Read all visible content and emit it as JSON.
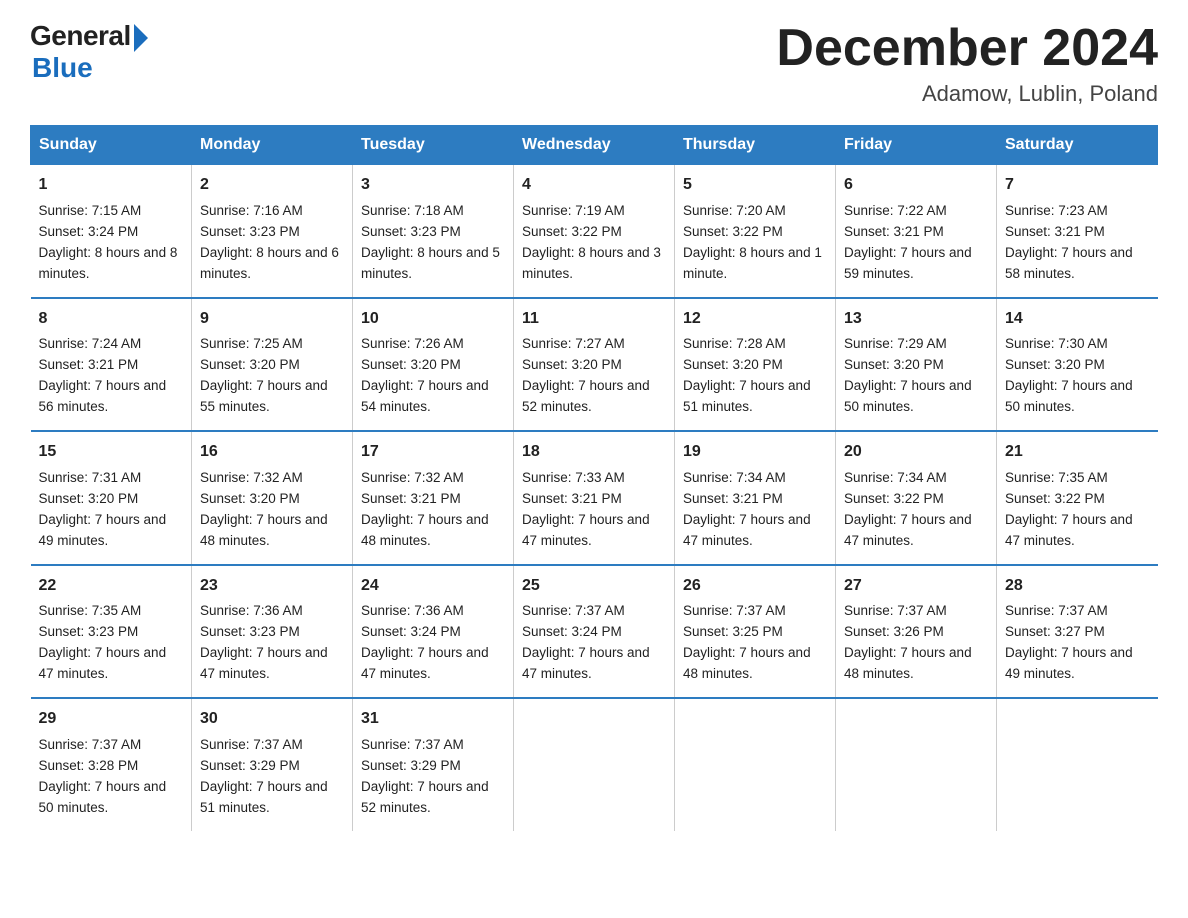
{
  "logo": {
    "general": "General",
    "blue": "Blue"
  },
  "title": "December 2024",
  "location": "Adamow, Lublin, Poland",
  "days_header": [
    "Sunday",
    "Monday",
    "Tuesday",
    "Wednesday",
    "Thursday",
    "Friday",
    "Saturday"
  ],
  "weeks": [
    [
      {
        "day": "1",
        "sunrise": "Sunrise: 7:15 AM",
        "sunset": "Sunset: 3:24 PM",
        "daylight": "Daylight: 8 hours and 8 minutes."
      },
      {
        "day": "2",
        "sunrise": "Sunrise: 7:16 AM",
        "sunset": "Sunset: 3:23 PM",
        "daylight": "Daylight: 8 hours and 6 minutes."
      },
      {
        "day": "3",
        "sunrise": "Sunrise: 7:18 AM",
        "sunset": "Sunset: 3:23 PM",
        "daylight": "Daylight: 8 hours and 5 minutes."
      },
      {
        "day": "4",
        "sunrise": "Sunrise: 7:19 AM",
        "sunset": "Sunset: 3:22 PM",
        "daylight": "Daylight: 8 hours and 3 minutes."
      },
      {
        "day": "5",
        "sunrise": "Sunrise: 7:20 AM",
        "sunset": "Sunset: 3:22 PM",
        "daylight": "Daylight: 8 hours and 1 minute."
      },
      {
        "day": "6",
        "sunrise": "Sunrise: 7:22 AM",
        "sunset": "Sunset: 3:21 PM",
        "daylight": "Daylight: 7 hours and 59 minutes."
      },
      {
        "day": "7",
        "sunrise": "Sunrise: 7:23 AM",
        "sunset": "Sunset: 3:21 PM",
        "daylight": "Daylight: 7 hours and 58 minutes."
      }
    ],
    [
      {
        "day": "8",
        "sunrise": "Sunrise: 7:24 AM",
        "sunset": "Sunset: 3:21 PM",
        "daylight": "Daylight: 7 hours and 56 minutes."
      },
      {
        "day": "9",
        "sunrise": "Sunrise: 7:25 AM",
        "sunset": "Sunset: 3:20 PM",
        "daylight": "Daylight: 7 hours and 55 minutes."
      },
      {
        "day": "10",
        "sunrise": "Sunrise: 7:26 AM",
        "sunset": "Sunset: 3:20 PM",
        "daylight": "Daylight: 7 hours and 54 minutes."
      },
      {
        "day": "11",
        "sunrise": "Sunrise: 7:27 AM",
        "sunset": "Sunset: 3:20 PM",
        "daylight": "Daylight: 7 hours and 52 minutes."
      },
      {
        "day": "12",
        "sunrise": "Sunrise: 7:28 AM",
        "sunset": "Sunset: 3:20 PM",
        "daylight": "Daylight: 7 hours and 51 minutes."
      },
      {
        "day": "13",
        "sunrise": "Sunrise: 7:29 AM",
        "sunset": "Sunset: 3:20 PM",
        "daylight": "Daylight: 7 hours and 50 minutes."
      },
      {
        "day": "14",
        "sunrise": "Sunrise: 7:30 AM",
        "sunset": "Sunset: 3:20 PM",
        "daylight": "Daylight: 7 hours and 50 minutes."
      }
    ],
    [
      {
        "day": "15",
        "sunrise": "Sunrise: 7:31 AM",
        "sunset": "Sunset: 3:20 PM",
        "daylight": "Daylight: 7 hours and 49 minutes."
      },
      {
        "day": "16",
        "sunrise": "Sunrise: 7:32 AM",
        "sunset": "Sunset: 3:20 PM",
        "daylight": "Daylight: 7 hours and 48 minutes."
      },
      {
        "day": "17",
        "sunrise": "Sunrise: 7:32 AM",
        "sunset": "Sunset: 3:21 PM",
        "daylight": "Daylight: 7 hours and 48 minutes."
      },
      {
        "day": "18",
        "sunrise": "Sunrise: 7:33 AM",
        "sunset": "Sunset: 3:21 PM",
        "daylight": "Daylight: 7 hours and 47 minutes."
      },
      {
        "day": "19",
        "sunrise": "Sunrise: 7:34 AM",
        "sunset": "Sunset: 3:21 PM",
        "daylight": "Daylight: 7 hours and 47 minutes."
      },
      {
        "day": "20",
        "sunrise": "Sunrise: 7:34 AM",
        "sunset": "Sunset: 3:22 PM",
        "daylight": "Daylight: 7 hours and 47 minutes."
      },
      {
        "day": "21",
        "sunrise": "Sunrise: 7:35 AM",
        "sunset": "Sunset: 3:22 PM",
        "daylight": "Daylight: 7 hours and 47 minutes."
      }
    ],
    [
      {
        "day": "22",
        "sunrise": "Sunrise: 7:35 AM",
        "sunset": "Sunset: 3:23 PM",
        "daylight": "Daylight: 7 hours and 47 minutes."
      },
      {
        "day": "23",
        "sunrise": "Sunrise: 7:36 AM",
        "sunset": "Sunset: 3:23 PM",
        "daylight": "Daylight: 7 hours and 47 minutes."
      },
      {
        "day": "24",
        "sunrise": "Sunrise: 7:36 AM",
        "sunset": "Sunset: 3:24 PM",
        "daylight": "Daylight: 7 hours and 47 minutes."
      },
      {
        "day": "25",
        "sunrise": "Sunrise: 7:37 AM",
        "sunset": "Sunset: 3:24 PM",
        "daylight": "Daylight: 7 hours and 47 minutes."
      },
      {
        "day": "26",
        "sunrise": "Sunrise: 7:37 AM",
        "sunset": "Sunset: 3:25 PM",
        "daylight": "Daylight: 7 hours and 48 minutes."
      },
      {
        "day": "27",
        "sunrise": "Sunrise: 7:37 AM",
        "sunset": "Sunset: 3:26 PM",
        "daylight": "Daylight: 7 hours and 48 minutes."
      },
      {
        "day": "28",
        "sunrise": "Sunrise: 7:37 AM",
        "sunset": "Sunset: 3:27 PM",
        "daylight": "Daylight: 7 hours and 49 minutes."
      }
    ],
    [
      {
        "day": "29",
        "sunrise": "Sunrise: 7:37 AM",
        "sunset": "Sunset: 3:28 PM",
        "daylight": "Daylight: 7 hours and 50 minutes."
      },
      {
        "day": "30",
        "sunrise": "Sunrise: 7:37 AM",
        "sunset": "Sunset: 3:29 PM",
        "daylight": "Daylight: 7 hours and 51 minutes."
      },
      {
        "day": "31",
        "sunrise": "Sunrise: 7:37 AM",
        "sunset": "Sunset: 3:29 PM",
        "daylight": "Daylight: 7 hours and 52 minutes."
      },
      null,
      null,
      null,
      null
    ]
  ]
}
